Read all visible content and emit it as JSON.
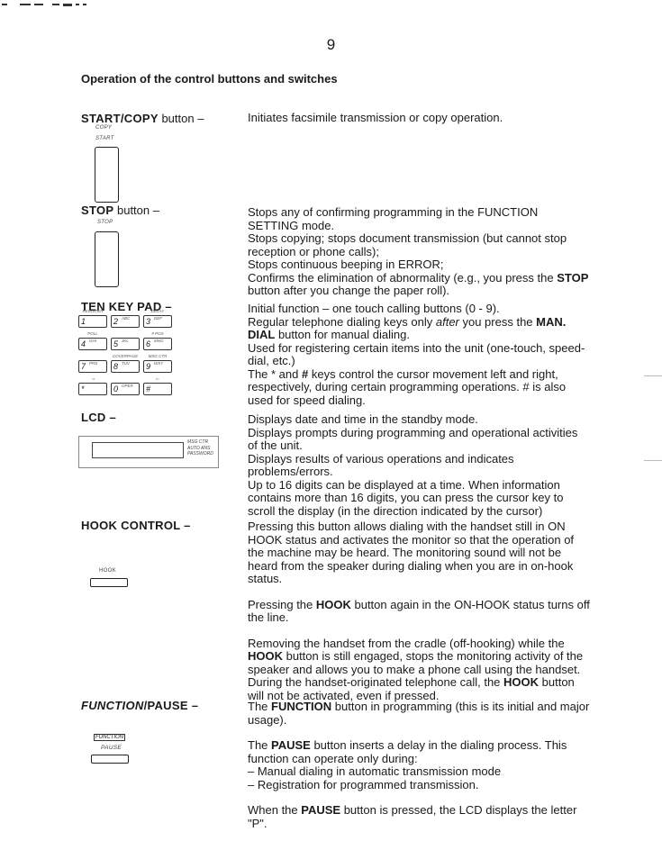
{
  "page": {
    "number": "9",
    "section_title": "Operation of the control buttons and switches"
  },
  "sections": {
    "start_copy": {
      "label_bold": "START/COPY",
      "label_rest": " button –",
      "panel_labels": [
        "COPY",
        "START"
      ],
      "description": [
        "Initiates facsimile transmission or copy operation."
      ]
    },
    "stop": {
      "label_bold": "STOP",
      "label_rest": " button –",
      "panel_labels": [
        "STOP"
      ],
      "description": [
        "Stops any of confirming programming in the FUNCTION SETTING mode.",
        "Stops copying; stops document transmission (but cannot stop reception or phone calls);",
        "Stops continuous beeping in ERROR;",
        "Confirms the elimination of abnormality (e.g., you press the ",
        "STOP",
        " button after you change the paper roll)."
      ]
    },
    "ten_key_pad": {
      "label_bold": "TEN KEY PAD –",
      "keys": [
        {
          "num": "1",
          "letters": "",
          "top": "REGISTER"
        },
        {
          "num": "2",
          "letters": "ABC",
          "top": ""
        },
        {
          "num": "3",
          "letters": "DEF",
          "top": "DELAY"
        },
        {
          "num": "4",
          "letters": "GHI",
          "top": "POLL"
        },
        {
          "num": "5",
          "letters": "JKL",
          "top": ""
        },
        {
          "num": "6",
          "letters": "MNO",
          "top": "# PGS"
        },
        {
          "num": "7",
          "letters": "PRS",
          "top": ""
        },
        {
          "num": "8",
          "letters": "TUV",
          "top": "COVERPAGE"
        },
        {
          "num": "9",
          "letters": "WXY",
          "top": "MSG CTR"
        },
        {
          "num": "*",
          "letters": "",
          "top": "◅"
        },
        {
          "num": "0",
          "letters": "OPER",
          "top": ""
        },
        {
          "num": "#",
          "letters": "",
          "top": "▻"
        }
      ],
      "description": {
        "line1": "Initial function – one touch calling buttons (0 - 9).",
        "line2_a": "Regular telephone dialing keys only ",
        "line2_em": "after",
        "line2_b": " you press the ",
        "line2_bold": "MAN. DIAL",
        "line2_c": " button for manual dialing.",
        "line3": "Used for registering certain items into the unit (one-touch, speed-dial, etc.)",
        "line4_a": "The  * and ",
        "line4_bold": "#",
        "line4_b": " keys control the cursor movement left and right, respectively, during certain programming operations.  # is also used for speed dialing."
      }
    },
    "lcd": {
      "label_bold": "LCD –",
      "indicators": [
        "MSG CTR",
        "AUTO ANS",
        "PASSWORD"
      ],
      "description": [
        "Displays date and time in the standby mode.",
        "Displays prompts during programming and operational activities of the unit.",
        "Displays results of various operations and indicates problems/errors.",
        "Up to 16 digits can be displayed at a time.  When information contains more than 16 digits, you can press the cursor key to scroll the display (in the direction indicated by the cursor)"
      ]
    },
    "hook_control": {
      "label_bold": "HOOK CONTROL –",
      "panel_labels": [
        "HOOK"
      ],
      "p1": "Pressing this button allows dialing with the handset still in ON HOOK status and activates the monitor so that the operation of the machine may be heard.  The monitoring sound will not be heard from the speaker during dialing when you are in on-hook status.",
      "p2_a": "Pressing the ",
      "p2_bold": "HOOK",
      "p2_b": " button again in the ON-HOOK status turns off the line.",
      "p3_a": "Removing the handset from the cradle (off-hooking) while the ",
      "p3_bold1": "HOOK",
      "p3_b": " button is still engaged, stops the monitoring activity of the speaker and allows you to make a phone call using the handset.  During the handset-originated telephone call, the ",
      "p3_bold2": "HOOK",
      "p3_c": " button will not be activated, even if pressed."
    },
    "function_pause": {
      "label_italic": "FUNCTION",
      "label_rest": "/PAUSE –",
      "panel_labels": [
        "FUNCTION",
        "PAUSE"
      ],
      "p1_a": "The ",
      "p1_bold": "FUNCTION",
      "p1_b": " button in programming (this is its initial and major usage).",
      "p2_a": "The ",
      "p2_bold": "PAUSE",
      "p2_b": " button inserts a delay in the dialing process.  This function can operate only during:",
      "p2_list": [
        "– Manual dialing in automatic transmission mode",
        "– Registration for programmed transmission."
      ],
      "p3_a": "When the ",
      "p3_bold": "PAUSE",
      "p3_b": " button is pressed, the LCD displays the letter \"P\"."
    }
  }
}
